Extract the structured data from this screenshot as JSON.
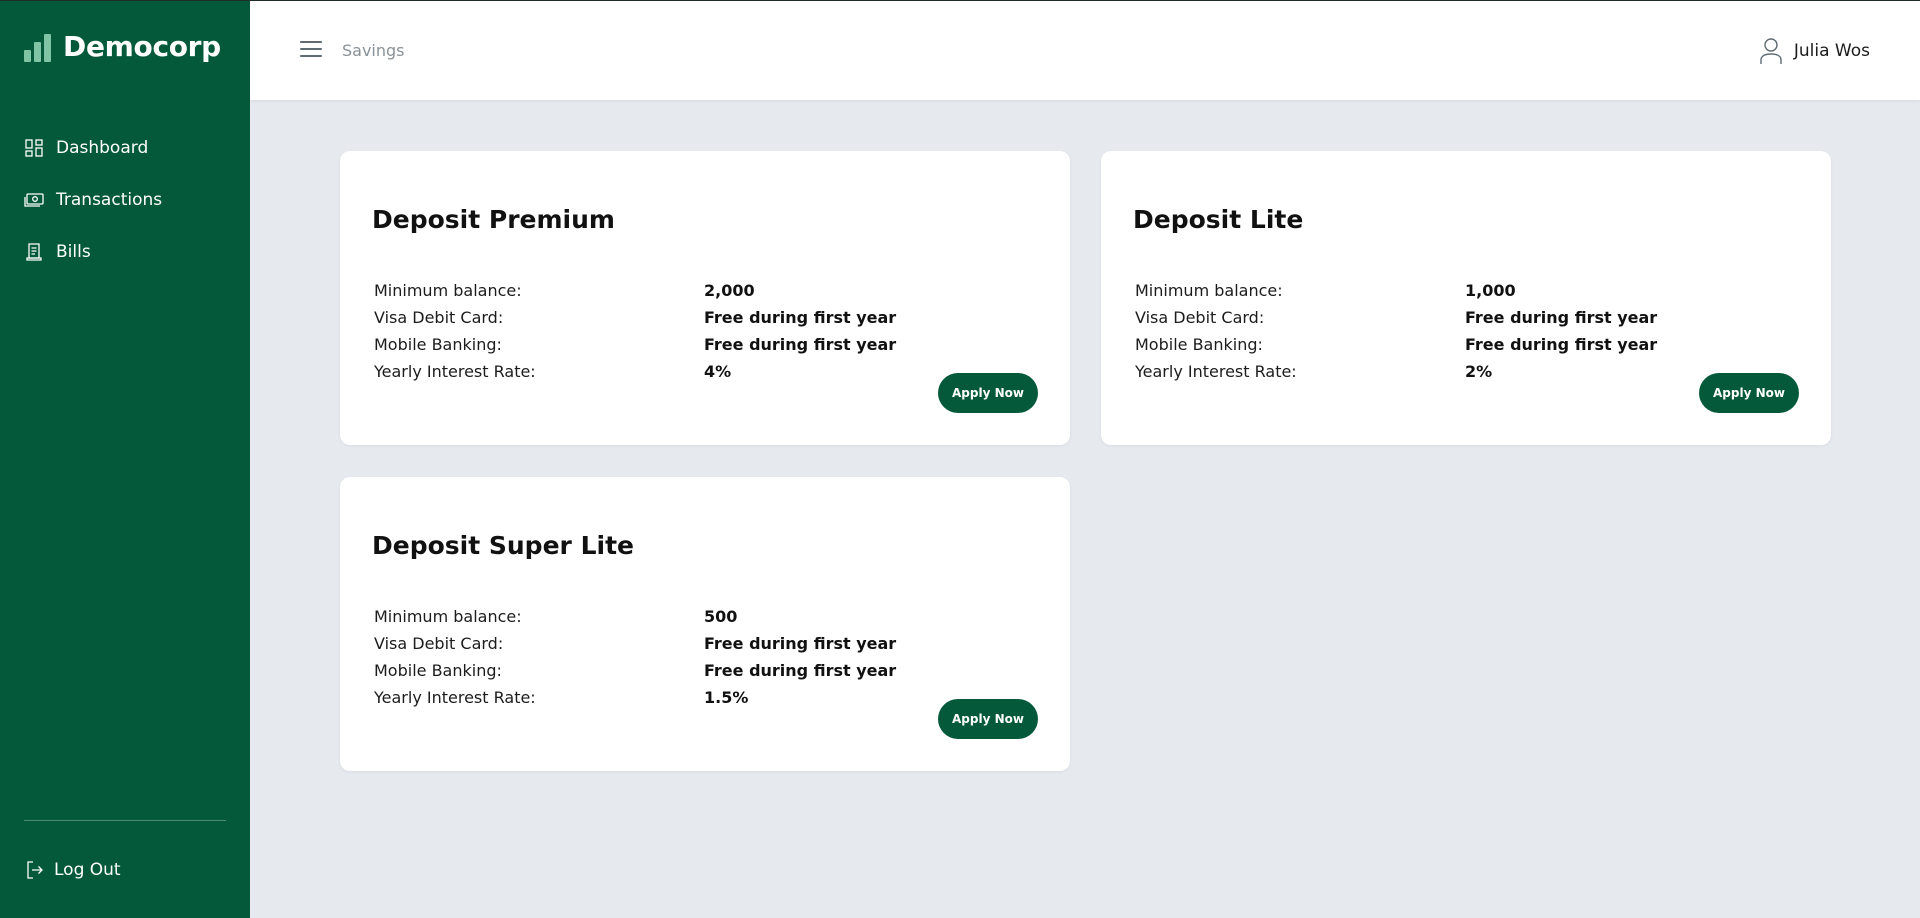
{
  "brand": {
    "name": "Democorp"
  },
  "sidebar": {
    "items": [
      {
        "label": "Dashboard",
        "icon": "dashboard-icon"
      },
      {
        "label": "Transactions",
        "icon": "cash-icon"
      },
      {
        "label": "Bills",
        "icon": "receipt-icon"
      }
    ],
    "logout_label": "Log Out"
  },
  "header": {
    "page_title": "Savings",
    "user_name": "Julia Wos"
  },
  "colors": {
    "sidebar_bg": "#04593a",
    "content_bg": "#e6eaee",
    "button_bg": "#04593a",
    "logo_accent": "#7fc4a4"
  },
  "cards": [
    {
      "title": "Deposit Premium",
      "rows": [
        {
          "label": "Minimum balance:",
          "value": "2,000"
        },
        {
          "label": "Visa Debit Card:",
          "value": "Free during first year"
        },
        {
          "label": "Mobile Banking:",
          "value": "Free during first year"
        },
        {
          "label": "Yearly Interest Rate:",
          "value": "4%"
        }
      ],
      "button_label": "Apply Now"
    },
    {
      "title": "Deposit Lite",
      "rows": [
        {
          "label": "Minimum balance:",
          "value": "1,000"
        },
        {
          "label": "Visa Debit Card:",
          "value": "Free during first year"
        },
        {
          "label": "Mobile Banking:",
          "value": "Free during first year"
        },
        {
          "label": "Yearly Interest Rate:",
          "value": "2%"
        }
      ],
      "button_label": "Apply Now"
    },
    {
      "title": "Deposit Super Lite",
      "rows": [
        {
          "label": "Minimum balance:",
          "value": "500"
        },
        {
          "label": "Visa Debit Card:",
          "value": "Free during first year"
        },
        {
          "label": "Mobile Banking:",
          "value": "Free during first year"
        },
        {
          "label": "Yearly Interest Rate:",
          "value": "1.5%"
        }
      ],
      "button_label": "Apply Now"
    }
  ]
}
